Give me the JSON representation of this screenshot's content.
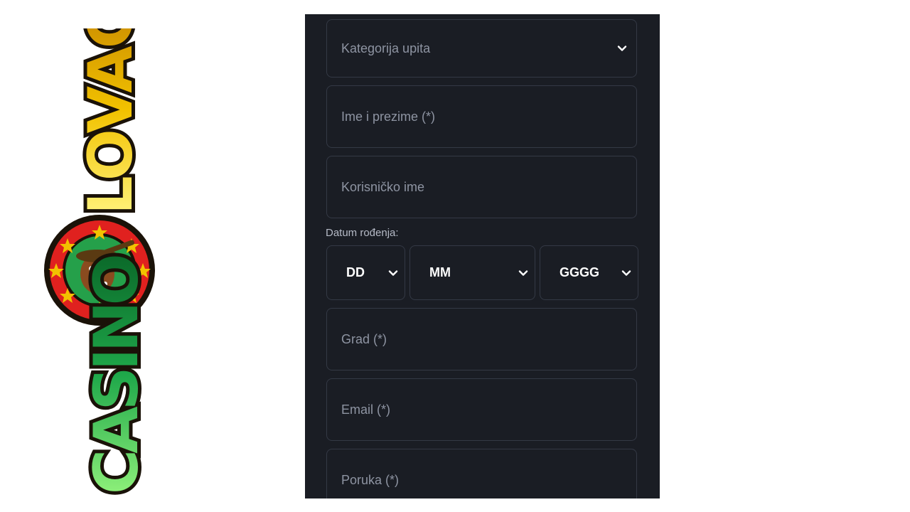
{
  "logo": {
    "text": "CASINOLOVAC",
    "word_top": "LOVAC",
    "word_bottom": "CASINO"
  },
  "form": {
    "category": {
      "placeholder": "Kategorija upita"
    },
    "full_name": {
      "placeholder": "Ime i prezime (*)"
    },
    "username": {
      "placeholder": "Korisničko ime"
    },
    "dob": {
      "label": "Datum rođenja:",
      "day": "DD",
      "month": "MM",
      "year": "GGGG"
    },
    "city": {
      "placeholder": "Grad (*)"
    },
    "email": {
      "placeholder": "Email (*)"
    },
    "message": {
      "placeholder": "Poruka (*)"
    }
  },
  "colors": {
    "panel_bg": "#1a1d24",
    "border": "#343945",
    "placeholder": "#8e94a2",
    "logo_gold": "#f2c200",
    "logo_green": "#1fa84a"
  }
}
